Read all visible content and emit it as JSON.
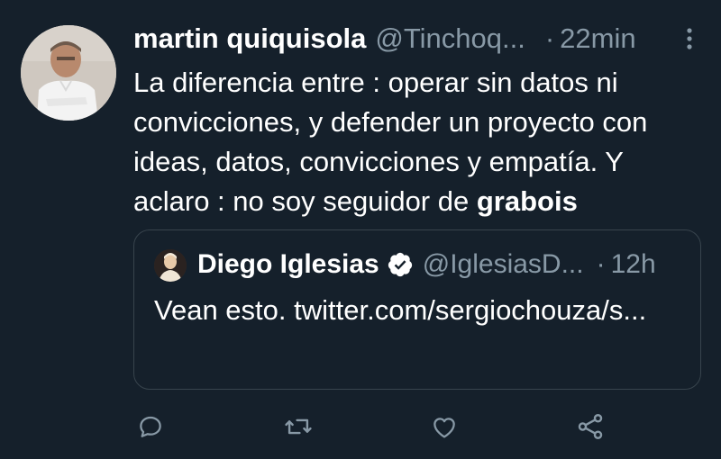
{
  "tweet": {
    "author_name": "martin quiquisola",
    "author_handle": "@Tinchoq...",
    "separator": "·",
    "time": "22min",
    "text_before_bold": "La diferencia entre : operar sin datos ni convicciones, y defender un proyecto con ideas, datos, convicciones y empatía. Y aclaro : no soy seguidor de ",
    "text_bold": "grabois"
  },
  "quoted_tweet": {
    "author_name": "Diego Iglesias",
    "author_handle": "@IglesiasD...",
    "separator": "·",
    "time": "12h",
    "text": "Vean esto. twitter.com/sergiochouza/s..."
  },
  "icons": {
    "more": "more-vertical-icon",
    "verified": "verified-badge-icon",
    "reply": "reply-icon",
    "retweet": "retweet-icon",
    "like": "like-icon",
    "share": "share-icon"
  },
  "colors": {
    "background": "#15202b",
    "secondary_text": "#8899a6",
    "border": "#38444d",
    "verified_badge": "#ffffff"
  }
}
